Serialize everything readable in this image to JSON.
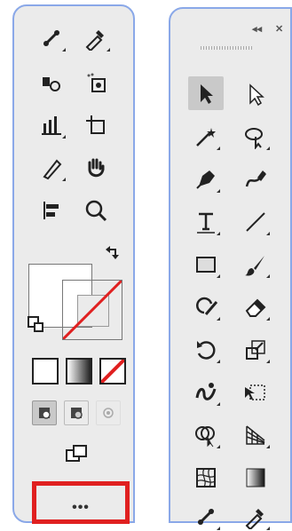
{
  "left_panel": {
    "more_tools_label": "•••"
  },
  "right_panel": {
    "collapse_label": "◂◂",
    "close_label": "✕"
  },
  "colors": {
    "panel_bg": "#ebebeb",
    "panel_border": "#8aa8e8",
    "selected_tool_bg": "#c9c9c9",
    "highlight_red": "#e02020",
    "none_red": "#e02020"
  },
  "icons": {
    "left_tools": [
      "blend-icon",
      "eyedropper-icon",
      "symbol-sprayer-icon",
      "live-paint-bucket-icon",
      "column-graph-icon",
      "artboard-icon",
      "slice-icon",
      "hand-icon",
      "align-icon",
      "zoom-icon"
    ],
    "right_tools": [
      "selection-icon",
      "direct-selection-icon",
      "magic-wand-icon",
      "lasso-icon",
      "pen-icon",
      "curvature-icon",
      "type-icon",
      "line-segment-icon",
      "rectangle-icon",
      "paintbrush-icon",
      "shaper-icon",
      "eraser-icon",
      "rotate-icon",
      "scale-icon",
      "warp-icon",
      "free-transform-icon",
      "shape-builder-icon",
      "perspective-grid-icon",
      "mesh-icon",
      "gradient-icon",
      "blend-icon",
      "eyedropper-icon"
    ]
  }
}
